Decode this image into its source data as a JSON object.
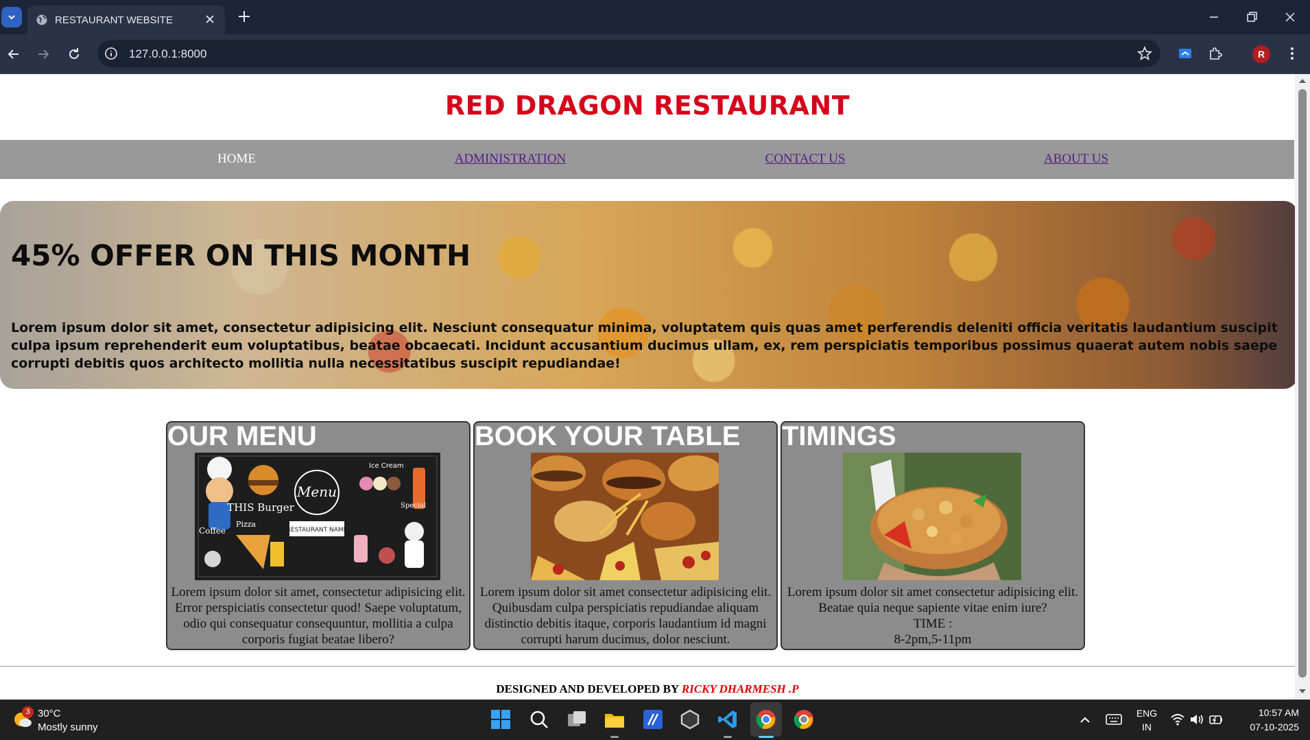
{
  "browser": {
    "tab_title": "RESTAURANT WEBSITE",
    "url": "127.0.0.1:8000",
    "profile_initial": "R"
  },
  "site": {
    "title": "RED DRAGON RESTAURANT",
    "nav": [
      "HOME",
      "ADMINISTRATION",
      "CONTACT US",
      "ABOUT US"
    ]
  },
  "hero": {
    "title": "45% OFFER ON THIS MONTH",
    "text": "Lorem ipsum dolor sit amet, consectetur adipisicing elit. Nesciunt consequatur minima, voluptatem quis quas amet perferendis deleniti officia veritatis laudantium suscipit culpa ipsum reprehenderit eum voluptatibus, beatae obcaecati. Incidunt accusantium ducimus ullam, ex, rem perspiciatis temporibus possimus quaerat autem nobis saepe corrupti debitis quos architecto mollitia nulla necessitatibus suscipit repudiandae!"
  },
  "cards": [
    {
      "title": "OUR MENU",
      "text": "Lorem ipsum dolor sit amet, consectetur adipisicing elit. Error perspiciatis consectetur quod! Saepe voluptatum, odio qui consequatur consequuntur, mollitia a culpa corporis fugiat beatae libero?"
    },
    {
      "title": "BOOK YOUR TABLE",
      "text": "Lorem ipsum dolor sit amet consectetur adipisicing elit. Quibusdam culpa perspiciatis repudiandae aliquam distinctio debitis itaque, corporis laudantium id magni corrupti harum ducimus, dolor nesciunt."
    },
    {
      "title": "TIMINGS",
      "text": "Lorem ipsum dolor sit amet consectetur adipisicing elit. Beatae quia neque sapiente vitae enim iure?",
      "time_label": "TIME :",
      "time_value": "8-2pm,5-11pm"
    }
  ],
  "menu_image_text": {
    "menu": "Menu",
    "this_burger": "THIS Burger",
    "restaurant_name": "RESTAURANT NAME",
    "ice_cream": "Ice Cream",
    "coffee": "Coffee",
    "pizza": "Pizza",
    "special": "Special"
  },
  "footer": {
    "prefix": "DESIGNED AND DEVELOPED BY",
    "author": "RICKY DHARMESH .P"
  },
  "taskbar": {
    "weather_temp": "30°C",
    "weather_condition": "Mostly sunny",
    "weather_badge": "3",
    "language": "ENG",
    "region": "IN",
    "time": "10:57 AM",
    "date": "07-10-2025"
  },
  "colors": {
    "brand_red": "#d6001c",
    "nav_bg": "#999999",
    "card_bg": "#8c8c8c",
    "chrome_bg": "#1c2538"
  }
}
